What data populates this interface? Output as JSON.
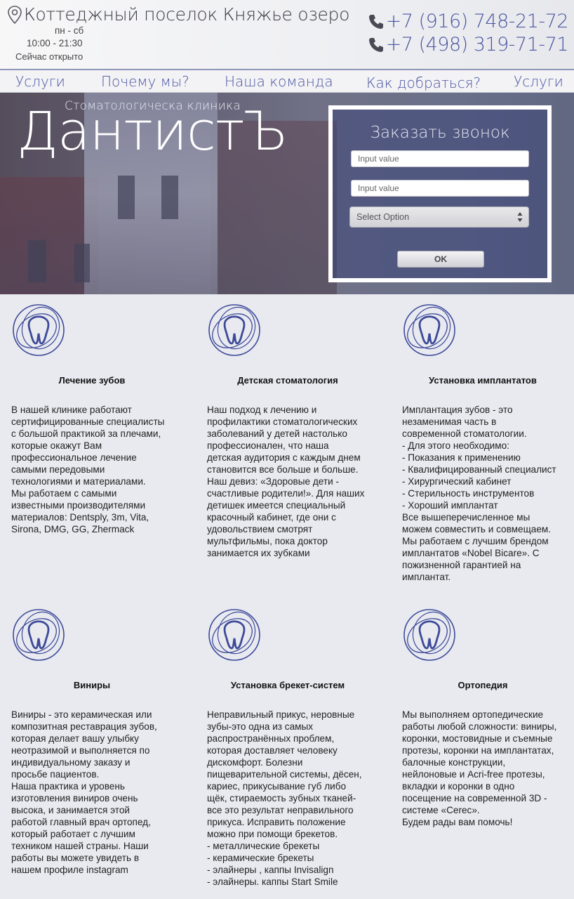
{
  "header": {
    "address": "Коттеджный поселок Княжье озеро",
    "hours_days": "пн - сб",
    "hours_time": "10:00 - 21:30",
    "status": "Сейчас открыто",
    "phones": [
      "+7 (916) 748-21-72",
      "+7 (498) 319-71-71"
    ]
  },
  "nav": {
    "items": [
      {
        "label": "Услуги"
      },
      {
        "label": "Почему мы?"
      },
      {
        "label": "Наша команда"
      },
      {
        "label": "Как добраться?"
      },
      {
        "label": "Услуги"
      }
    ]
  },
  "hero": {
    "subtitle": "Стоматологическа клиника",
    "brand": "ДантистЪ"
  },
  "callback_form": {
    "title": "Заказать звонок",
    "input1_placeholder": "Input value",
    "input2_placeholder": "Input value",
    "select_value": "Select Option",
    "submit_label": "OK"
  },
  "services": [
    {
      "title": "Лечение зубов",
      "text": "В нашей клинике работают\nсертифицированные специалисты\nс большой практикой за плечами,\nкоторые окажут Вам\nпрофессиональное лечение\nсамыми передовыми\nтехнологиями и материалами.\nМы работаем с самыми\nизвестными производителями\nматериалов: Dentsply, 3m, Vita,\nSirona, DMG, GG, Zhermack"
    },
    {
      "title": "Детская стоматология",
      "text": "Наш подход к лечению и\nпрофилактики стоматологических\nзаболеваний у детей настолько\nпрофессионален, что наша\nдетская аудитория с каждым днем\nстановится все больше и больше.\nНаш девиз: «Здоровые дети -\nсчастливые родители!». Для наших\nдетишек имеется специальный\nкрасочный кабинет, где они с\nудовольствием смотрят\nмультфильмы, пока доктор\nзанимается их зубками"
    },
    {
      "title": "Установка имплантатов",
      "text": "Имплантация зубов - это\nнезаменимая часть в\nсовременной стоматологии.\n- Для этого необходимо:\n- Показания к применению\n- Квалифицированный специалист\n- Хирургический кабинет\n- Стерильность инструментов\n- Хороший имплантат\nВсе вышеперечисленное мы\nможем совместить и совмещаем.\nМы работаем с лучшим брендом\nимплантатов «Nobel Bicare». С\nпожизненной гарантией на\nимплантат."
    },
    {
      "title": "Виниры",
      "text": "Виниры - это керамическая или\nкомпозитная реставрация зубов,\nкоторая делает вашу улыбку\nнеотразимой и выполняется по\nиндивидуальному заказу и\nпросьбе пациентов.\nНаша практика и уровень\nизготовления виниров очень\nвысока, и занимается этой\nработой главный врач ортопед,\nкоторый работает с лучшим\nтехником нашей страны. Наши\nработы вы можете увидеть в\nнашем профиле instagram"
    },
    {
      "title": "Установка брекет-систем",
      "text": "Неправильный прикус, неровные\nзубы-это одна из самых\nраспространённых проблем,\nкоторая доставляет человеку\nдискомфорт. Болезни\nпищеварительной системы, дёсен,\nкариес, прикусывание губ либо\nщёк, стираемость зубных тканей-\nвсе это результат неправильного\nприкуса. Исправить положение\nможно при помощи брекетов.\n- металлические брекеты\n- керамические брекеты\n- элайнеры , каппы Invisalign\n- элайнеры. каппы Start Smile"
    },
    {
      "title": "Ортопедия",
      "text": "Мы выполняем ортопедические\nработы любой сложности: виниры,\nкоронки, мостовидные и съемные\nпротезы, коронки на имплантатах,\nбалочные конструкции,\nнейлоновые и Acri-free протезы,\nвкладки и коронки в одно\nпосещение на современной 3D -\nсистеме «Cerec».\nБудем рады вам помочь!"
    }
  ],
  "icons": {
    "location": "map-pin-icon",
    "phone": "phone-icon",
    "service": "tooth-logo-icon"
  },
  "colors": {
    "accent": "#4a55a2",
    "background": "#e9eaf0"
  }
}
